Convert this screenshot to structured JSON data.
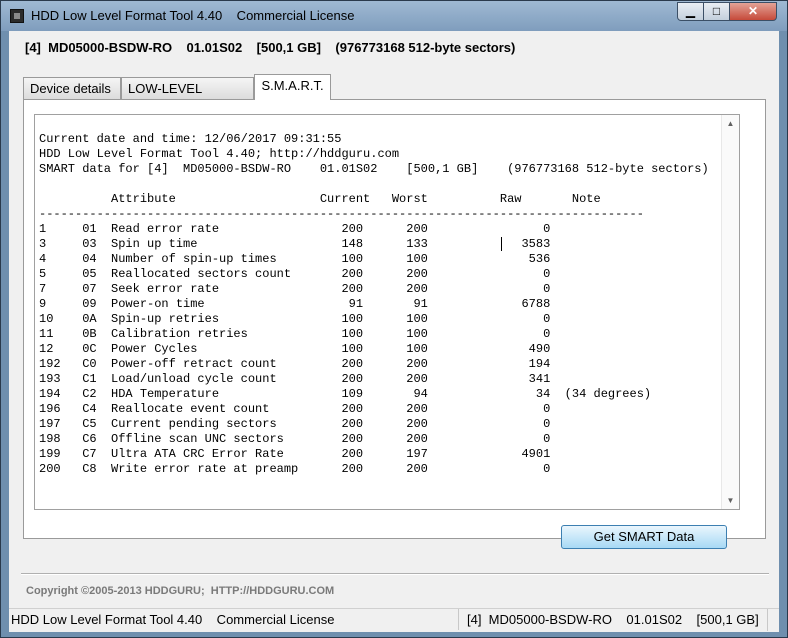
{
  "window": {
    "title": "HDD Low Level Format Tool 4.40    Commercial License",
    "minimize_glyph": "▁",
    "maximize_glyph": "□",
    "close_glyph": "✕"
  },
  "device_header": "[4]  MD05000-BSDW-RO    01.01S02    [500,1 GB]    (976773168 512-byte sectors)",
  "tabs": [
    {
      "label": "Device details"
    },
    {
      "label": "LOW-LEVEL FORMAT"
    },
    {
      "label": "S.M.A.R.T."
    }
  ],
  "smart": {
    "report_lines": [
      "Current date and time: 12/06/2017 09:31:55",
      "HDD Low Level Format Tool 4.40; http://hddguru.com",
      "SMART data for [4]  MD05000-BSDW-RO    01.01S02    [500,1 GB]    (976773168 512-byte sectors)",
      "",
      "          Attribute                    Current   Worst          Raw       Note",
      "------------------------------------------------------------------------------------",
      "1     01  Read error rate                 200      200                0",
      "3     03  Spin up time                    148      133             3583",
      "4     04  Number of spin-up times         100      100              536",
      "5     05  Reallocated sectors count       200      200                0",
      "7     07  Seek error rate                 200      200                0",
      "9     09  Power-on time                    91       91             6788",
      "10    0A  Spin-up retries                 100      100                0",
      "11    0B  Calibration retries             100      100                0",
      "12    0C  Power Cycles                    100      100              490",
      "192   C0  Power-off retract count         200      200              194",
      "193   C1  Load/unload cycle count         200      200              341",
      "194   C2  HDA Temperature                 109       94               34  (34 degrees)",
      "196   C4  Reallocate event count          200      200                0",
      "197   C5  Current pending sectors         200      200                0",
      "198   C6  Offline scan UNC sectors        200      200                0",
      "199   C7  Ultra ATA CRC Error Rate        200      197             4901",
      "200   C8  Write error rate at preamp      200      200                0"
    ],
    "scroll_up_glyph": "▲",
    "scroll_down_glyph": "▼",
    "get_button_label": "Get SMART Data"
  },
  "copyright": "Copyright ©2005-2013 HDDGURU;  HTTP://HDDGURU.COM",
  "statusbar": {
    "left": "HDD Low Level Format Tool 4.40    Commercial License",
    "right": "[4]  MD05000-BSDW-RO    01.01S02    [500,1 GB]    ("
  }
}
